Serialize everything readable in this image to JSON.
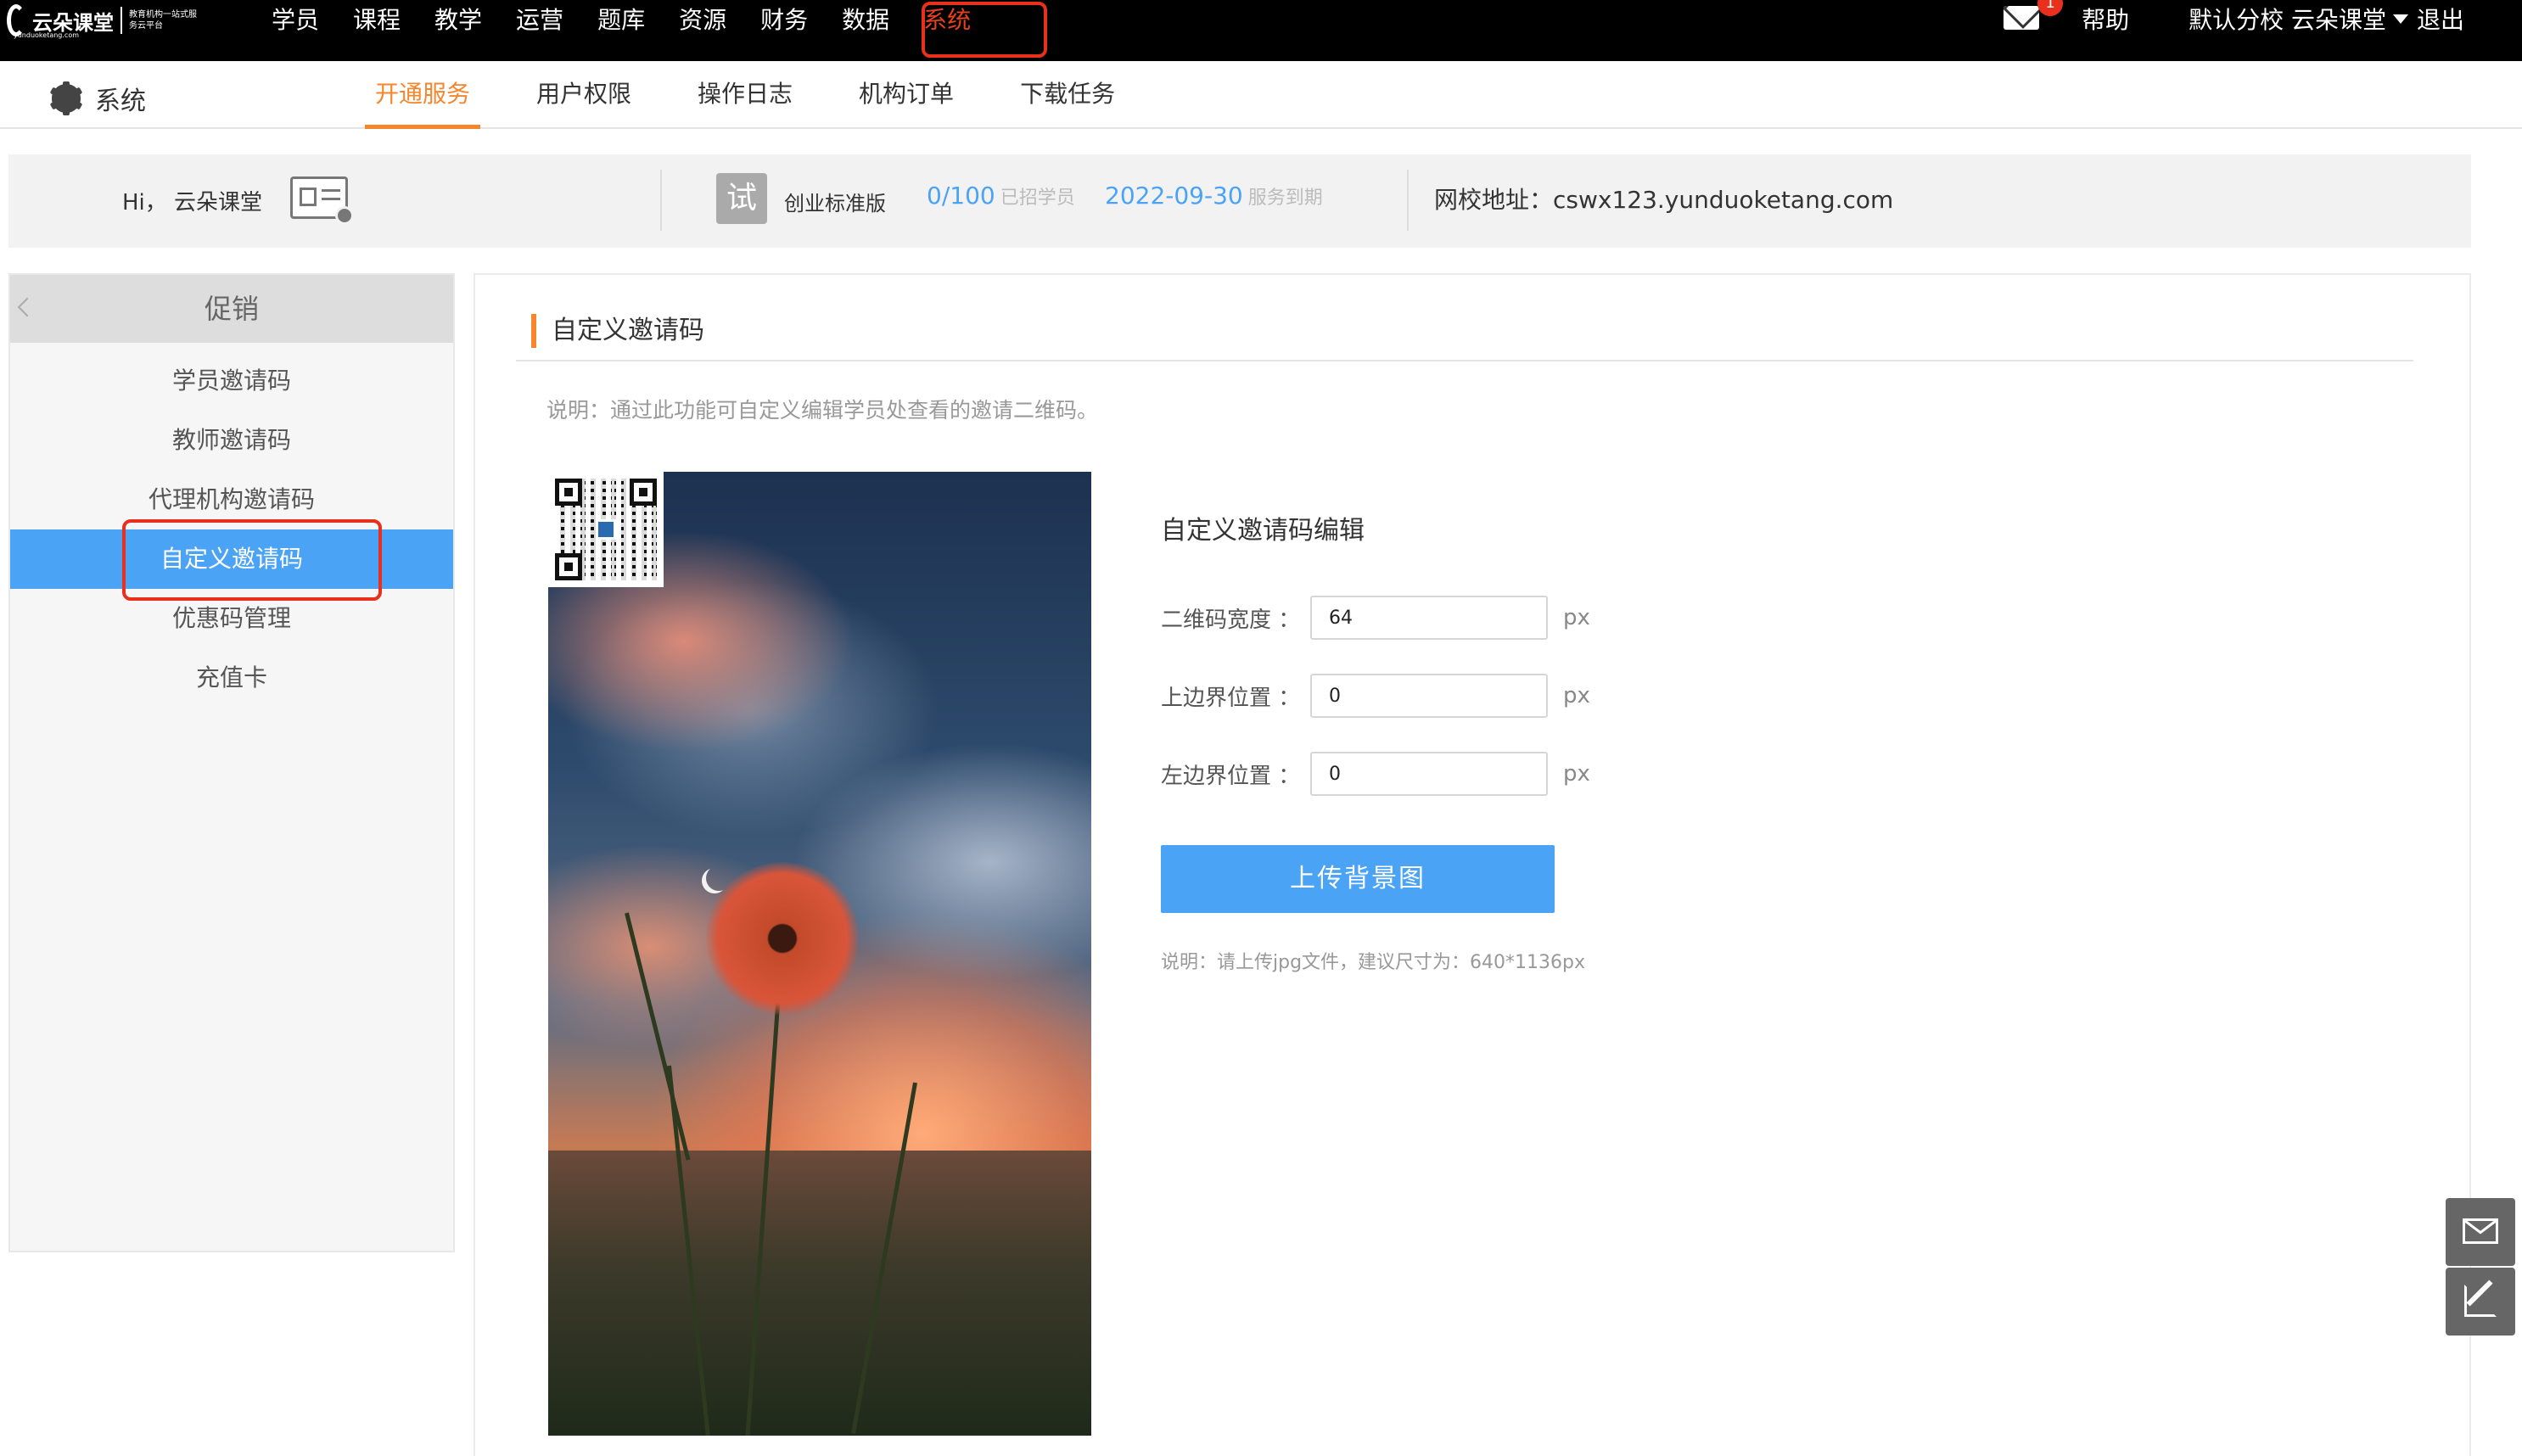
{
  "logo": {
    "name": "云朵课堂",
    "slogan": "教育机构一站式服务云平台",
    "domain": "yunduoketang.com"
  },
  "main_nav": [
    {
      "label": "学员"
    },
    {
      "label": "课程"
    },
    {
      "label": "教学"
    },
    {
      "label": "运营"
    },
    {
      "label": "题库"
    },
    {
      "label": "资源"
    },
    {
      "label": "财务"
    },
    {
      "label": "数据"
    },
    {
      "label": "系统",
      "active": true
    }
  ],
  "topbar": {
    "mail_badge": "1",
    "help": "帮助",
    "branch": "默认分校 云朵课堂",
    "logout": "退出"
  },
  "subnav": {
    "title": "系统",
    "tabs": [
      "开通服务",
      "用户权限",
      "操作日志",
      "机构订单",
      "下载任务"
    ],
    "active_tab": "开通服务"
  },
  "infobar": {
    "greeting": "Hi， 云朵课堂",
    "trial_badge": "试",
    "edition": "创业标准版",
    "students_value": "0/100",
    "students_label": "已招学员",
    "expire_value": "2022-09-30",
    "expire_label": "服务到期",
    "school_url": "网校地址：cswx123.yunduoketang.com"
  },
  "sidebar": {
    "heading": "促销",
    "items": [
      "学员邀请码",
      "教师邀请码",
      "代理机构邀请码",
      "自定义邀请码",
      "优惠码管理",
      "充值卡"
    ],
    "active_item": "自定义邀请码"
  },
  "content": {
    "title": "自定义邀请码",
    "description": "说明：通过此功能可自定义编辑学员处查看的邀请二维码。",
    "form_title": "自定义邀请码编辑",
    "fields": [
      {
        "label": "二维码宽度 ：",
        "value": "64",
        "unit": "px"
      },
      {
        "label": "上边界位置 ：",
        "value": "0",
        "unit": "px"
      },
      {
        "label": "左边界位置 ：",
        "value": "0",
        "unit": "px"
      }
    ],
    "upload_button": "上传背景图",
    "upload_note": "说明：请上传jpg文件，建议尺寸为：640*1136px"
  },
  "colors": {
    "topbar_bg": "#000000",
    "accent_orange": "#f5862c",
    "primary_blue": "#4aa3f5",
    "highlight_red": "#e8301c"
  }
}
